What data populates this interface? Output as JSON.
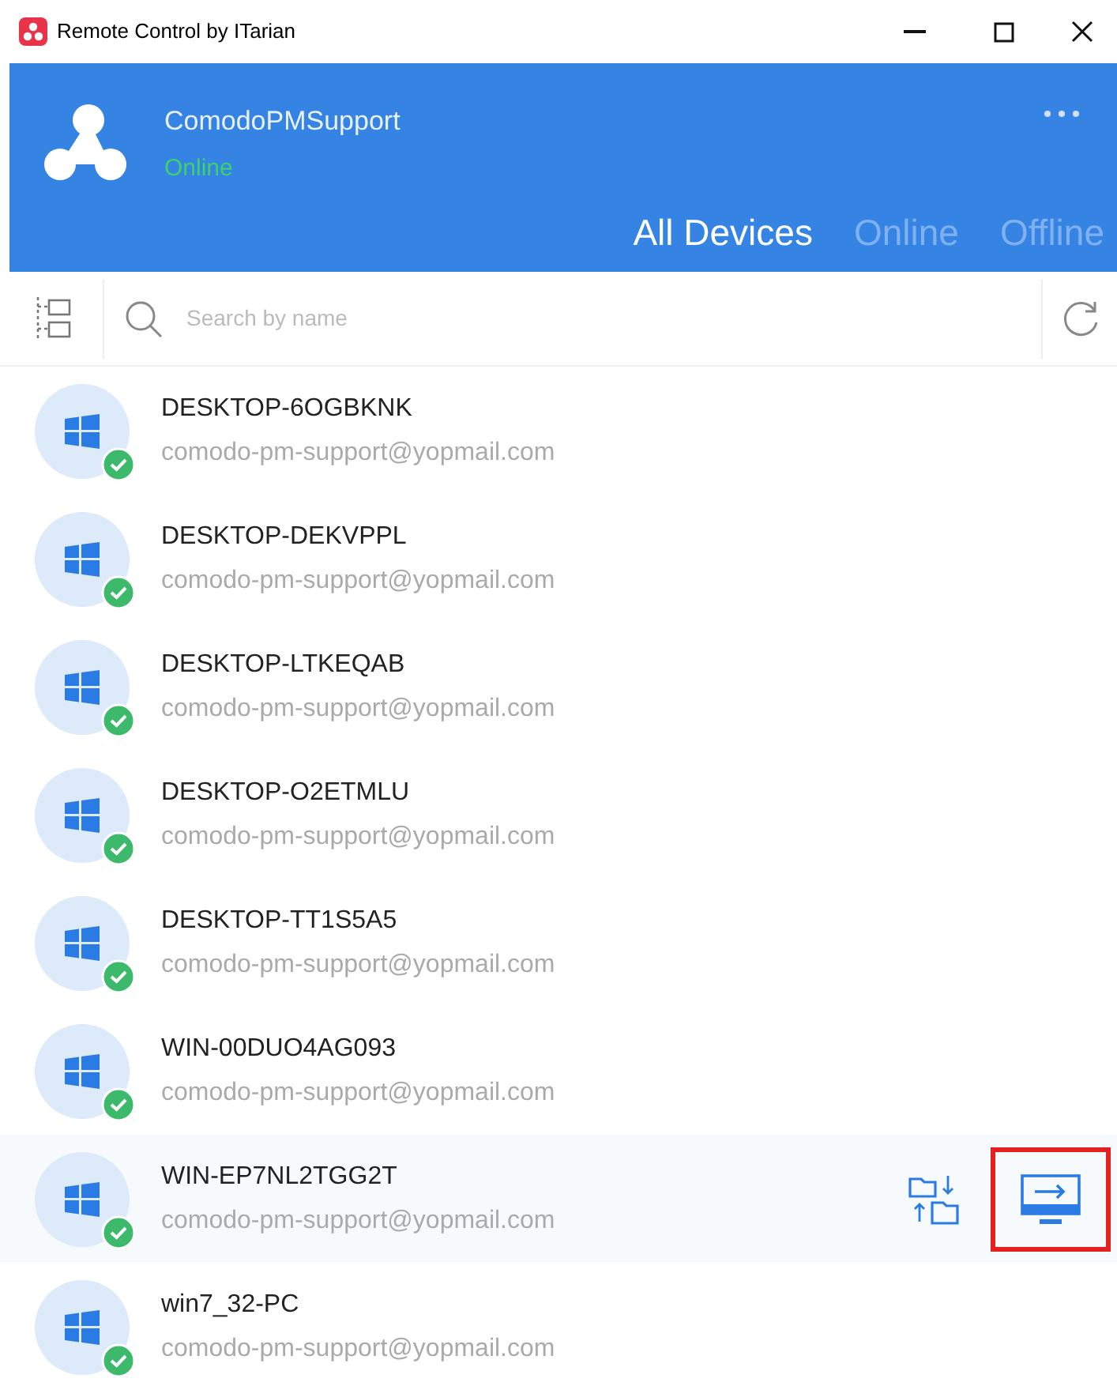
{
  "window": {
    "title": "Remote Control by ITarian"
  },
  "account": {
    "name": "ComodoPMSupport",
    "status": "Online"
  },
  "tabs": [
    {
      "label": "All Devices",
      "selected": true
    },
    {
      "label": "Online",
      "selected": false
    },
    {
      "label": "Offline",
      "selected": false
    }
  ],
  "search": {
    "placeholder": "Search by name"
  },
  "devices": [
    {
      "name": "DESKTOP-6OGBKNK",
      "email": "comodo-pm-support@yopmail.com",
      "online": true,
      "hovered": false,
      "highlighted": false
    },
    {
      "name": "DESKTOP-DEKVPPL",
      "email": "comodo-pm-support@yopmail.com",
      "online": true,
      "hovered": false,
      "highlighted": false
    },
    {
      "name": "DESKTOP-LTKEQAB",
      "email": "comodo-pm-support@yopmail.com",
      "online": true,
      "hovered": false,
      "highlighted": false
    },
    {
      "name": "DESKTOP-O2ETMLU",
      "email": "comodo-pm-support@yopmail.com",
      "online": true,
      "hovered": false,
      "highlighted": false
    },
    {
      "name": "DESKTOP-TT1S5A5",
      "email": "comodo-pm-support@yopmail.com",
      "online": true,
      "hovered": false,
      "highlighted": false
    },
    {
      "name": "WIN-00DUO4AG093",
      "email": "comodo-pm-support@yopmail.com",
      "online": true,
      "hovered": false,
      "highlighted": false
    },
    {
      "name": "WIN-EP7NL2TGG2T",
      "email": "comodo-pm-support@yopmail.com",
      "online": true,
      "hovered": true,
      "highlighted": true
    },
    {
      "name": "win7_32-PC",
      "email": "comodo-pm-support@yopmail.com",
      "online": true,
      "hovered": false,
      "highlighted": false
    }
  ]
}
